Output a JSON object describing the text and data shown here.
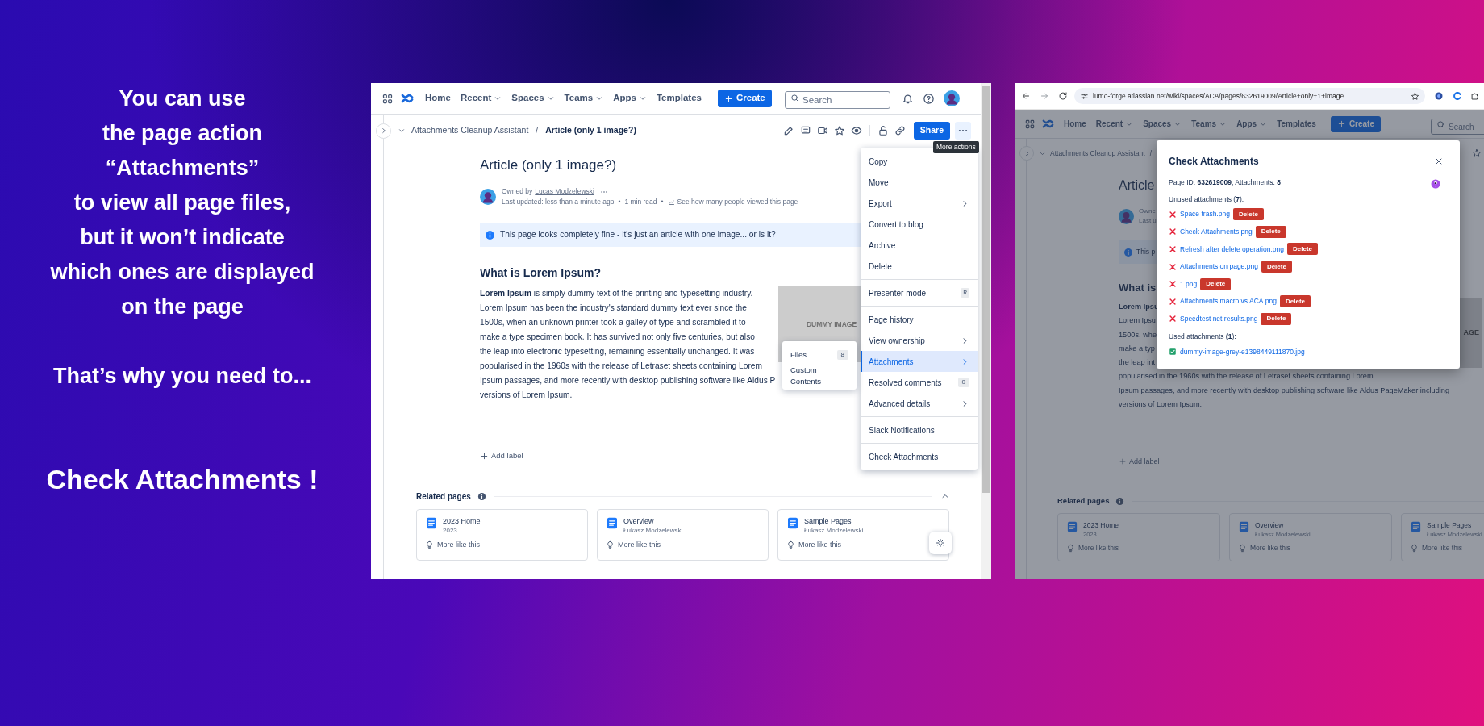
{
  "promo": {
    "lines": [
      "You can use",
      "the page action",
      "“Attachments”",
      "to view all page files,",
      "but it won’t indicate",
      "which ones are displayed",
      "on the page"
    ],
    "lead": "That’s why you need to...",
    "cta": "Check Attachments !"
  },
  "left_window": {
    "nav": {
      "items": [
        {
          "label": "Home",
          "dropdown": false
        },
        {
          "label": "Recent",
          "dropdown": true
        },
        {
          "label": "Spaces",
          "dropdown": true
        },
        {
          "label": "Teams",
          "dropdown": true
        },
        {
          "label": "Apps",
          "dropdown": true
        },
        {
          "label": "Templates",
          "dropdown": false
        }
      ],
      "create": "Create",
      "search_placeholder": "Search"
    },
    "breadcrumb": {
      "parent": "Attachments Cleanup Assistant",
      "separator": "/",
      "current": "Article (only 1 image?)"
    },
    "share": "Share",
    "tooltip": "More actions",
    "page": {
      "title": "Article (only 1 image?)",
      "owner_prefix": "Owned by",
      "owner": "Lucas Modzelewski",
      "meta": [
        "Last updated: less than a minute ago",
        "•",
        "1 min read",
        "•"
      ],
      "views_link": "See how many people viewed this page",
      "info": "This page looks completely fine - it's just an article with one image... or is it?",
      "heading": "What is Lorem Ipsum?",
      "paragraph_lines": [
        "**Lorem Ipsum** is simply dummy text of the printing and typesetting industry.",
        "Lorem Ipsum has been the industry's standard dummy text ever since the",
        "1500s, when an unknown printer took a galley of type and scrambled it to",
        "make a type specimen book. It has survived not only five centuries, but also",
        "the leap into electronic typesetting, remaining essentially unchanged. It was",
        "popularised in the 1960s with the release of Letraset sheets containing Lorem",
        "Ipsum passages, and more recently with desktop publishing software like Aldus P",
        "versions of Lorem Ipsum."
      ],
      "image_label": "DUMMY IMAGE",
      "add_label": "Add label"
    },
    "menu": [
      {
        "kind": "item",
        "label": "Copy",
        "submenu": false,
        "selected": false
      },
      {
        "kind": "item",
        "label": "Move",
        "submenu": false,
        "selected": false
      },
      {
        "kind": "item",
        "label": "Export",
        "submenu": true,
        "selected": false
      },
      {
        "kind": "item",
        "label": "Convert to blog",
        "submenu": false,
        "selected": false
      },
      {
        "kind": "item",
        "label": "Archive",
        "submenu": false,
        "selected": false
      },
      {
        "kind": "item",
        "label": "Delete",
        "submenu": false,
        "selected": false
      },
      {
        "kind": "divider"
      },
      {
        "kind": "item",
        "label": "Presenter mode",
        "shortcut": "R",
        "submenu": false,
        "selected": false
      },
      {
        "kind": "divider"
      },
      {
        "kind": "item",
        "label": "Page history",
        "submenu": false,
        "selected": false
      },
      {
        "kind": "item",
        "label": "View ownership",
        "submenu": true,
        "selected": false
      },
      {
        "kind": "item",
        "label": "Attachments",
        "submenu": true,
        "selected": true
      },
      {
        "kind": "item",
        "label": "Resolved comments",
        "count": "0",
        "submenu": false,
        "selected": false
      },
      {
        "kind": "item",
        "label": "Advanced details",
        "submenu": true,
        "selected": false
      },
      {
        "kind": "divider"
      },
      {
        "kind": "item",
        "label": "Slack Notifications",
        "submenu": false,
        "selected": false
      },
      {
        "kind": "divider"
      },
      {
        "kind": "item",
        "label": "Check Attachments",
        "submenu": false,
        "selected": false
      }
    ],
    "submenu": [
      {
        "label": "Files",
        "count": "8"
      },
      {
        "label": "Custom Contents"
      }
    ],
    "related": {
      "title": "Related pages",
      "cards": [
        {
          "title": "2023 Home",
          "subtitle": "2023",
          "action": "More like this"
        },
        {
          "title": "Overview",
          "subtitle": "Łukasz Modzelewski",
          "action": "More like this"
        },
        {
          "title": "Sample Pages",
          "subtitle": "Łukasz Modzelewski",
          "action": "More like this"
        }
      ]
    }
  },
  "right_window": {
    "url": "lumo-forge.atlassian.net/wiki/spaces/ACA/pages/632619009/Article+only+1+image",
    "nav": {
      "items": [
        {
          "label": "Home",
          "dropdown": false
        },
        {
          "label": "Recent",
          "dropdown": true
        },
        {
          "label": "Spaces",
          "dropdown": true
        },
        {
          "label": "Teams",
          "dropdown": true
        },
        {
          "label": "Apps",
          "dropdown": true
        },
        {
          "label": "Templates",
          "dropdown": false
        }
      ],
      "create": "Create",
      "search_placeholder": "Search"
    },
    "breadcrumb": {
      "parent": "Attachments Cleanup Assistant",
      "separator": "/"
    },
    "page": {
      "title": "Article",
      "owner_fragment": "Owne",
      "meta_fragment": "Last u",
      "info_fragment": "This p",
      "heading": "What is",
      "paragraph_fragments": [
        "Lorem Ipsu",
        "Lorem Ipsu",
        "1500s, whe",
        "make a typ",
        "the leap int"
      ],
      "paragraph_lines": [
        "popularised in the 1960s with the release of Letraset sheets containing Lorem",
        "Ipsum passages, and more recently with desktop publishing software like Aldus PageMaker including",
        "versions of Lorem Ipsum."
      ],
      "image_label": "AGE",
      "add_label": "Add label",
      "related": {
        "title": "Related pages",
        "cards": [
          {
            "title": "2023 Home",
            "subtitle": "2023",
            "action": "More like this"
          },
          {
            "title": "Overview",
            "subtitle": "Łukasz Modzelewski",
            "action": "More like this"
          },
          {
            "title": "Sample Pages",
            "subtitle": "Łukasz Modzelewski",
            "action": "More like this"
          }
        ]
      }
    },
    "modal": {
      "title": "Check Attachments",
      "summary": "Page ID: **632619009**, Attachments: **8**",
      "unused_heading": "Unused attachments (**7**):",
      "unused": [
        {
          "name": "Space trash.png",
          "action": "Delete"
        },
        {
          "name": "Check Attachments.png",
          "action": "Delete"
        },
        {
          "name": "Refresh after delete operation.png",
          "action": "Delete"
        },
        {
          "name": "Attachments on page.png",
          "action": "Delete"
        },
        {
          "name": "1.png",
          "action": "Delete"
        },
        {
          "name": "Attachments macro vs ACA.png",
          "action": "Delete"
        },
        {
          "name": "Speedtest net results.png",
          "action": "Delete"
        }
      ],
      "used_heading": "Used attachments (**1**):",
      "used": [
        {
          "name": "dummy-image-grey-e1398449111870.jpg"
        }
      ]
    }
  }
}
